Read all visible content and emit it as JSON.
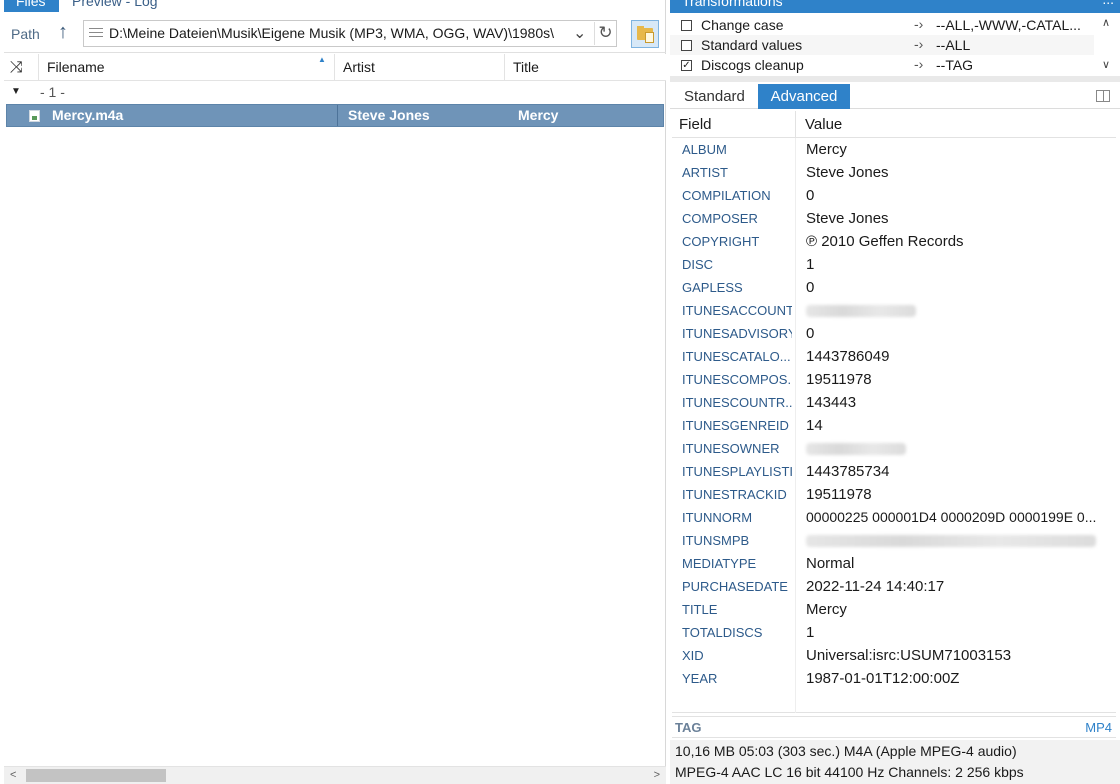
{
  "left_tabs": {
    "files": "Files",
    "preview_log": "Preview - Log"
  },
  "path": {
    "label": "Path",
    "value": "D:\\Meine Dateien\\Musik\\Eigene Musik (MP3, WMA, OGG, WAV)\\1980s\\"
  },
  "file_list": {
    "columns": [
      "Filename",
      "Artist",
      "Title"
    ],
    "group_label": "- 1 -",
    "rows": [
      {
        "filename": "Mercy.m4a",
        "artist": "Steve Jones",
        "title": "Mercy"
      }
    ]
  },
  "transformations": {
    "title": "Transformations",
    "more": "...",
    "items": [
      {
        "name": "Change case",
        "checked": false,
        "arg": "--ALL,-WWW,-CATAL..."
      },
      {
        "name": "Standard values",
        "checked": false,
        "arg": "--ALL"
      },
      {
        "name": "Discogs cleanup",
        "checked": true,
        "arg": "--TAG"
      }
    ]
  },
  "tag_tabs": {
    "standard": "Standard",
    "advanced": "Advanced"
  },
  "tag_grid": {
    "headers": {
      "field": "Field",
      "value": "Value"
    },
    "rows": [
      {
        "field": "ALBUM",
        "value": "Mercy"
      },
      {
        "field": "ARTIST",
        "value": "Steve Jones"
      },
      {
        "field": "COMPILATION",
        "value": "0"
      },
      {
        "field": "COMPOSER",
        "value": "Steve Jones"
      },
      {
        "field": "COPYRIGHT",
        "value": "℗ 2010 Geffen Records"
      },
      {
        "field": "DISC",
        "value": "1"
      },
      {
        "field": "GAPLESS",
        "value": "0"
      },
      {
        "field": "ITUNESACCOUNT",
        "value": ""
      },
      {
        "field": "ITUNESADVISORY",
        "value": "0"
      },
      {
        "field": "ITUNESCATALO...",
        "value": "1443786049"
      },
      {
        "field": "ITUNESCOMPOS...",
        "value": "19511978"
      },
      {
        "field": "ITUNESCOUNTR...",
        "value": "143443"
      },
      {
        "field": "ITUNESGENREID",
        "value": "14"
      },
      {
        "field": "ITUNESOWNER",
        "value": ""
      },
      {
        "field": "ITUNESPLAYLISTID",
        "value": "1443785734"
      },
      {
        "field": "ITUNESTRACKID",
        "value": "19511978"
      },
      {
        "field": "ITUNNORM",
        "value": " 00000225 000001D4 0000209D 0000199E 0..."
      },
      {
        "field": "ITUNSMPB",
        "value": ""
      },
      {
        "field": "MEDIATYPE",
        "value": "Normal"
      },
      {
        "field": "PURCHASEDATE",
        "value": "2022-11-24 14:40:17"
      },
      {
        "field": "TITLE",
        "value": "Mercy"
      },
      {
        "field": "TOTALDISCS",
        "value": "1"
      },
      {
        "field": "XID",
        "value": "Universal:isrc:USUM71003153"
      },
      {
        "field": "YEAR",
        "value": "1987-01-01T12:00:00Z"
      }
    ]
  },
  "tag_footer": {
    "tag": "TAG",
    "format": "MP4"
  },
  "status": {
    "line1": "10,16 MB  05:03 (303 sec.)  M4A  (Apple MPEG-4 audio)",
    "line2": "MPEG-4 AAC LC  16 bit  44100 Hz  Channels: 2  256 kbps"
  },
  "colors": {
    "accent": "#2f82c9",
    "selected_row": "#6f94b8",
    "field_text": "#2d5a8a"
  },
  "icons": {
    "up": "up-arrow-icon",
    "refresh": "refresh-icon",
    "folder": "folder-icon",
    "shuffle": "shuffle-icon",
    "sort": "sort-ascending-icon"
  }
}
